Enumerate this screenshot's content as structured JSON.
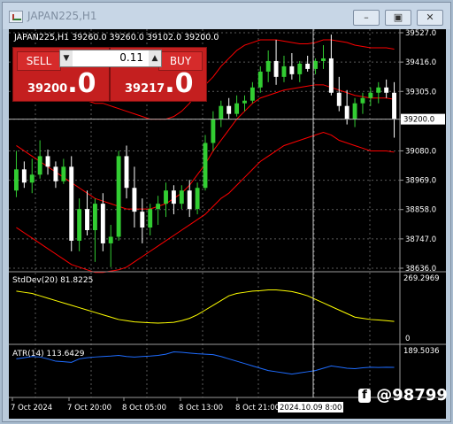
{
  "window": {
    "title": "JAPAN225,H1"
  },
  "chart_header": "JAPAN225,H1  39260.0 39260.0 39102.0 39200.0",
  "trade_panel": {
    "sell_label": "SELL",
    "buy_label": "BUY",
    "lot": "0.11",
    "sell_price_main": "39200",
    "sell_price_big": ".0",
    "buy_price_main": "39217",
    "buy_price_big": ".0"
  },
  "price_axis": [
    "39527.0",
    "39416.0",
    "39305.0",
    "39200.0",
    "39080.0",
    "38969.0",
    "38858.0",
    "38747.0",
    "38636.0"
  ],
  "current_price": "39200.0",
  "stddev": {
    "label": "StdDev(20) 81.8225",
    "axis_top": "269.2969",
    "axis_bottom": "0"
  },
  "atr": {
    "label": "ATR(14) 113.6429",
    "axis_top": "189.5036"
  },
  "time_axis": [
    "7 Oct 2024",
    "7 Oct 20:00",
    "8 Oct 05:00",
    "8 Oct 13:00",
    "8 Oct 21:00"
  ],
  "cursor_time": "2024.10.09 8:00",
  "watermark": "@98799",
  "colors": {
    "bull": "#32cd32",
    "bear": "#ffffff",
    "bands": "#ff0000",
    "stddev": "#ffff00",
    "atr": "#1e6cff",
    "background": "#000000"
  },
  "chart_data": {
    "type": "candlestick",
    "title": "JAPAN225,H1",
    "ylim": [
      38636.0,
      39527.0
    ],
    "candles": [
      {
        "o": 38930,
        "h": 39080,
        "l": 38905,
        "c": 39010
      },
      {
        "o": 39010,
        "h": 39040,
        "l": 38940,
        "c": 38960
      },
      {
        "o": 38960,
        "h": 39050,
        "l": 38920,
        "c": 38990
      },
      {
        "o": 38990,
        "h": 39120,
        "l": 38975,
        "c": 39060
      },
      {
        "o": 39060,
        "h": 39085,
        "l": 38990,
        "c": 39020
      },
      {
        "o": 39020,
        "h": 39040,
        "l": 38940,
        "c": 38965
      },
      {
        "o": 38965,
        "h": 39050,
        "l": 38955,
        "c": 39020
      },
      {
        "o": 39020,
        "h": 39060,
        "l": 38700,
        "c": 38740
      },
      {
        "o": 38740,
        "h": 38900,
        "l": 38700,
        "c": 38860
      },
      {
        "o": 38860,
        "h": 38930,
        "l": 38760,
        "c": 38780
      },
      {
        "o": 38780,
        "h": 38900,
        "l": 38660,
        "c": 38880
      },
      {
        "o": 38880,
        "h": 38920,
        "l": 38700,
        "c": 38730
      },
      {
        "o": 38730,
        "h": 38800,
        "l": 38640,
        "c": 38755
      },
      {
        "o": 38755,
        "h": 39080,
        "l": 38740,
        "c": 39060
      },
      {
        "o": 39060,
        "h": 39100,
        "l": 38900,
        "c": 38940
      },
      {
        "o": 38940,
        "h": 39020,
        "l": 38790,
        "c": 38850
      },
      {
        "o": 38850,
        "h": 38900,
        "l": 38730,
        "c": 38790
      },
      {
        "o": 38790,
        "h": 38880,
        "l": 38760,
        "c": 38860
      },
      {
        "o": 38860,
        "h": 38910,
        "l": 38800,
        "c": 38880
      },
      {
        "o": 38880,
        "h": 38960,
        "l": 38830,
        "c": 38930
      },
      {
        "o": 38930,
        "h": 38950,
        "l": 38840,
        "c": 38880
      },
      {
        "o": 38880,
        "h": 38950,
        "l": 38860,
        "c": 38930
      },
      {
        "o": 38930,
        "h": 38970,
        "l": 38830,
        "c": 38860
      },
      {
        "o": 38860,
        "h": 38960,
        "l": 38840,
        "c": 38940
      },
      {
        "o": 38940,
        "h": 39140,
        "l": 38930,
        "c": 39110
      },
      {
        "o": 39110,
        "h": 39230,
        "l": 39080,
        "c": 39200
      },
      {
        "o": 39200,
        "h": 39270,
        "l": 39170,
        "c": 39250
      },
      {
        "o": 39250,
        "h": 39280,
        "l": 39200,
        "c": 39220
      },
      {
        "o": 39220,
        "h": 39290,
        "l": 39210,
        "c": 39260
      },
      {
        "o": 39260,
        "h": 39290,
        "l": 39230,
        "c": 39270
      },
      {
        "o": 39270,
        "h": 39340,
        "l": 39260,
        "c": 39320
      },
      {
        "o": 39320,
        "h": 39400,
        "l": 39300,
        "c": 39380
      },
      {
        "o": 39380,
        "h": 39460,
        "l": 39340,
        "c": 39420
      },
      {
        "o": 39420,
        "h": 39500,
        "l": 39330,
        "c": 39360
      },
      {
        "o": 39360,
        "h": 39440,
        "l": 39340,
        "c": 39400
      },
      {
        "o": 39400,
        "h": 39450,
        "l": 39350,
        "c": 39370
      },
      {
        "o": 39370,
        "h": 39420,
        "l": 39340,
        "c": 39410
      },
      {
        "o": 39410,
        "h": 39440,
        "l": 39380,
        "c": 39390
      },
      {
        "o": 39390,
        "h": 39430,
        "l": 39370,
        "c": 39420
      },
      {
        "o": 39420,
        "h": 39480,
        "l": 39390,
        "c": 39430
      },
      {
        "o": 39430,
        "h": 39520,
        "l": 39290,
        "c": 39300
      },
      {
        "o": 39300,
        "h": 39360,
        "l": 39230,
        "c": 39250
      },
      {
        "o": 39250,
        "h": 39310,
        "l": 39180,
        "c": 39200
      },
      {
        "o": 39200,
        "h": 39280,
        "l": 39170,
        "c": 39260
      },
      {
        "o": 39260,
        "h": 39300,
        "l": 39220,
        "c": 39280
      },
      {
        "o": 39280,
        "h": 39320,
        "l": 39250,
        "c": 39300
      },
      {
        "o": 39300,
        "h": 39340,
        "l": 39260,
        "c": 39320
      },
      {
        "o": 39320,
        "h": 39350,
        "l": 39280,
        "c": 39300
      },
      {
        "o": 39300,
        "h": 39340,
        "l": 39130,
        "c": 39200
      }
    ],
    "bands_upper": [
      39420,
      39400,
      39380,
      39360,
      39350,
      39330,
      39300,
      39290,
      39280,
      39270,
      39260,
      39260,
      39250,
      39240,
      39230,
      39220,
      39210,
      39200,
      39200,
      39200,
      39210,
      39230,
      39260,
      39300,
      39330,
      39360,
      39400,
      39430,
      39460,
      39480,
      39490,
      39500,
      39500,
      39500,
      39495,
      39490,
      39485,
      39485,
      39490,
      39500,
      39500,
      39495,
      39490,
      39480,
      39475,
      39470,
      39470,
      39470,
      39465
    ],
    "bands_middle": [
      39100,
      39080,
      39060,
      39040,
      39020,
      39000,
      38980,
      38960,
      38940,
      38920,
      38900,
      38890,
      38880,
      38870,
      38860,
      38860,
      38860,
      38860,
      38870,
      38880,
      38900,
      38920,
      38950,
      38990,
      39030,
      39080,
      39120,
      39160,
      39200,
      39230,
      39260,
      39280,
      39290,
      39300,
      39310,
      39315,
      39320,
      39325,
      39330,
      39330,
      39320,
      39310,
      39300,
      39290,
      39285,
      39280,
      39280,
      39280,
      39275
    ],
    "bands_lower": [
      38790,
      38770,
      38750,
      38730,
      38710,
      38690,
      38670,
      38650,
      38640,
      38630,
      38620,
      38620,
      38625,
      38630,
      38640,
      38660,
      38680,
      38700,
      38720,
      38740,
      38760,
      38780,
      38800,
      38820,
      38840,
      38870,
      38900,
      38920,
      38950,
      38980,
      39010,
      39040,
      39060,
      39080,
      39100,
      39110,
      39120,
      39130,
      39140,
      39150,
      39140,
      39120,
      39110,
      39100,
      39090,
      39080,
      39080,
      39080,
      39075
    ],
    "stddev_series": [
      210,
      205,
      200,
      190,
      180,
      170,
      160,
      150,
      140,
      130,
      120,
      110,
      100,
      90,
      85,
      80,
      78,
      76,
      75,
      76,
      78,
      85,
      95,
      110,
      130,
      150,
      170,
      190,
      200,
      205,
      210,
      212,
      215,
      215,
      212,
      208,
      200,
      190,
      175,
      160,
      145,
      130,
      115,
      100,
      95,
      90,
      88,
      85,
      82
    ],
    "stddev_ylim": [
      0,
      269.2969
    ],
    "atr_series": [
      150,
      155,
      160,
      158,
      150,
      140,
      138,
      135,
      150,
      155,
      158,
      160,
      162,
      165,
      160,
      158,
      160,
      162,
      165,
      170,
      180,
      178,
      175,
      172,
      170,
      168,
      160,
      150,
      140,
      130,
      120,
      110,
      100,
      95,
      90,
      85,
      90,
      95,
      100,
      110,
      120,
      115,
      110,
      108,
      112,
      114,
      113,
      114,
      113.6
    ],
    "atr_ylim": [
      0,
      189.5036
    ]
  }
}
